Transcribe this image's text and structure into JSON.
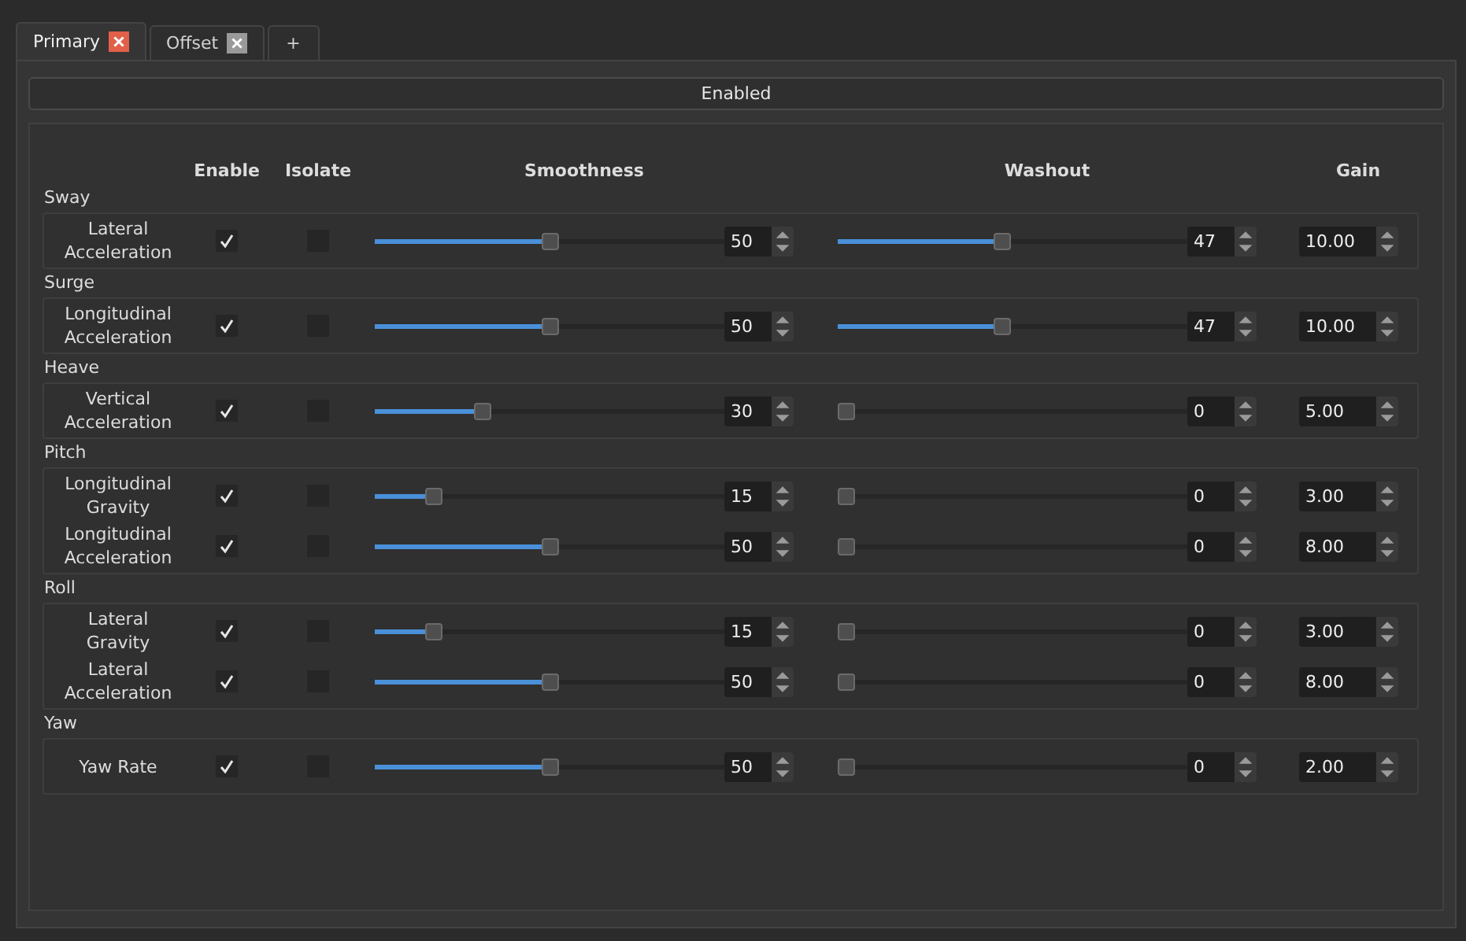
{
  "tabs": [
    {
      "label": "Primary",
      "kind": "tab",
      "selected": true
    },
    {
      "label": "Offset",
      "kind": "tab",
      "selected": false
    },
    {
      "label": "+",
      "kind": "add",
      "selected": false
    }
  ],
  "enabled_button": "Enabled",
  "columns": {
    "enable": "Enable",
    "isolate": "Isolate",
    "smoothness": "Smoothness",
    "washout": "Washout",
    "gain": "Gain"
  },
  "groups": [
    {
      "name": "Sway",
      "rows": [
        {
          "label": "Lateral Acceleration",
          "enable": true,
          "isolate": false,
          "smoothness": {
            "level": 0.5,
            "value": "50"
          },
          "washout": {
            "level": 0.47,
            "value": "47"
          },
          "gain": "10.00"
        }
      ]
    },
    {
      "name": "Surge",
      "rows": [
        {
          "label": "Longitudinal Acceleration",
          "enable": true,
          "isolate": false,
          "smoothness": {
            "level": 0.5,
            "value": "50"
          },
          "washout": {
            "level": 0.47,
            "value": "47"
          },
          "gain": "10.00"
        }
      ]
    },
    {
      "name": "Heave",
      "rows": [
        {
          "label": "Vertical Acceleration",
          "enable": true,
          "isolate": false,
          "smoothness": {
            "level": 0.3,
            "value": "30"
          },
          "washout": {
            "level": 0,
            "value": "0"
          },
          "gain": "5.00"
        }
      ]
    },
    {
      "name": "Pitch",
      "rows": [
        {
          "label": "Longitudinal Gravity",
          "enable": true,
          "isolate": false,
          "smoothness": {
            "level": 0.15,
            "value": "15"
          },
          "washout": {
            "level": 0,
            "value": "0"
          },
          "gain": "3.00"
        },
        {
          "label": "Longitudinal Acceleration",
          "enable": true,
          "isolate": false,
          "smoothness": {
            "level": 0.5,
            "value": "50"
          },
          "washout": {
            "level": 0,
            "value": "0"
          },
          "gain": "8.00"
        }
      ]
    },
    {
      "name": "Roll",
      "rows": [
        {
          "label": "Lateral Gravity",
          "enable": true,
          "isolate": false,
          "smoothness": {
            "level": 0.15,
            "value": "15"
          },
          "washout": {
            "level": 0,
            "value": "0"
          },
          "gain": "3.00"
        },
        {
          "label": "Lateral Acceleration",
          "enable": true,
          "isolate": false,
          "smoothness": {
            "level": 0.5,
            "value": "50"
          },
          "washout": {
            "level": 0,
            "value": "0"
          },
          "gain": "8.00"
        }
      ]
    },
    {
      "name": "Yaw",
      "rows": [
        {
          "label": "Yaw Rate",
          "enable": true,
          "isolate": false,
          "smoothness": {
            "level": 0.5,
            "value": "50"
          },
          "washout": {
            "level": 0,
            "value": "0"
          },
          "gain": "2.00"
        }
      ]
    }
  ]
}
